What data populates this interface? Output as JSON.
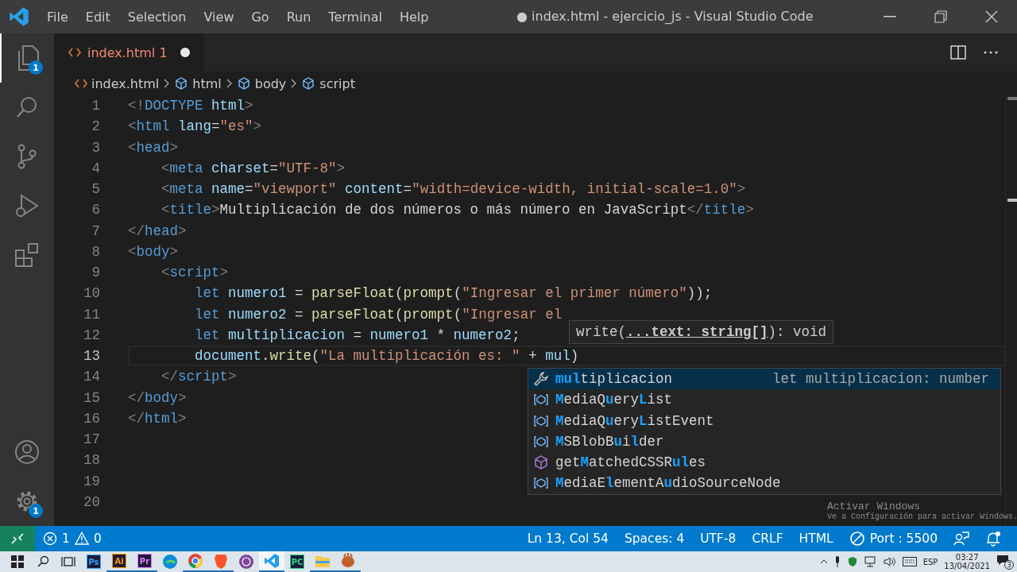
{
  "window": {
    "title": "● index.html - ejercicio_js - Visual Studio Code"
  },
  "menu": [
    "File",
    "Edit",
    "Selection",
    "View",
    "Go",
    "Run",
    "Terminal",
    "Help"
  ],
  "activity_bar": {
    "items": [
      {
        "kind": "files",
        "badge": "1",
        "selected": true
      },
      {
        "kind": "search",
        "selected": false
      },
      {
        "kind": "source-control",
        "selected": false
      },
      {
        "kind": "run",
        "selected": false
      },
      {
        "kind": "extensions",
        "selected": false
      }
    ],
    "bottom": [
      {
        "kind": "account"
      },
      {
        "kind": "settings",
        "badge": "1"
      }
    ]
  },
  "tabs": [
    {
      "label": "index.html",
      "problems": "1",
      "dirty": true,
      "selected": true
    }
  ],
  "breadcrumb": [
    {
      "kind": "file",
      "label": "index.html"
    },
    {
      "kind": "element",
      "label": "html"
    },
    {
      "kind": "element",
      "label": "body"
    },
    {
      "kind": "element",
      "label": "script"
    }
  ],
  "editor": {
    "lines": [
      {
        "number": "1",
        "current": false,
        "tokens": [
          {
            "kind": "punct",
            "text": "<!"
          },
          {
            "kind": "tag",
            "text": "DOCTYPE"
          },
          {
            "kind": "attr",
            "text": " html"
          },
          {
            "kind": "punct",
            "text": ">"
          }
        ]
      },
      {
        "number": "2",
        "current": false,
        "tokens": [
          {
            "kind": "punct",
            "text": "<"
          },
          {
            "kind": "tag",
            "text": "html"
          },
          {
            "kind": "attr",
            "text": " lang"
          },
          {
            "kind": "text",
            "text": "="
          },
          {
            "kind": "str",
            "text": "\"es\""
          },
          {
            "kind": "punct",
            "text": ">"
          }
        ]
      },
      {
        "number": "3",
        "current": false,
        "tokens": [
          {
            "kind": "punct",
            "text": "<"
          },
          {
            "kind": "tag",
            "text": "head"
          },
          {
            "kind": "punct",
            "text": ">"
          }
        ]
      },
      {
        "number": "4",
        "current": false,
        "tokens": [
          {
            "kind": "punct",
            "text": "    <"
          },
          {
            "kind": "tag",
            "text": "meta"
          },
          {
            "kind": "attr",
            "text": " charset"
          },
          {
            "kind": "text",
            "text": "="
          },
          {
            "kind": "str",
            "text": "\"UTF-8\""
          },
          {
            "kind": "punct",
            "text": ">"
          }
        ]
      },
      {
        "number": "5",
        "current": false,
        "tokens": [
          {
            "kind": "punct",
            "text": "    <"
          },
          {
            "kind": "tag",
            "text": "meta"
          },
          {
            "kind": "attr",
            "text": " name"
          },
          {
            "kind": "text",
            "text": "="
          },
          {
            "kind": "str",
            "text": "\"viewport\""
          },
          {
            "kind": "attr",
            "text": " content"
          },
          {
            "kind": "text",
            "text": "="
          },
          {
            "kind": "str",
            "text": "\"width=device-width, initial-scale=1.0\""
          },
          {
            "kind": "punct",
            "text": ">"
          }
        ]
      },
      {
        "number": "6",
        "current": false,
        "tokens": [
          {
            "kind": "punct",
            "text": "    <"
          },
          {
            "kind": "tag",
            "text": "title"
          },
          {
            "kind": "punct",
            "text": ">"
          },
          {
            "kind": "text",
            "text": "Multiplicación de dos números o más número en JavaScript"
          },
          {
            "kind": "punct",
            "text": "</"
          },
          {
            "kind": "tag",
            "text": "title"
          },
          {
            "kind": "punct",
            "text": ">"
          }
        ]
      },
      {
        "number": "7",
        "current": false,
        "tokens": [
          {
            "kind": "punct",
            "text": "</"
          },
          {
            "kind": "tag",
            "text": "head"
          },
          {
            "kind": "punct",
            "text": ">"
          }
        ]
      },
      {
        "number": "8",
        "current": false,
        "tokens": [
          {
            "kind": "punct",
            "text": "<"
          },
          {
            "kind": "tag",
            "text": "body"
          },
          {
            "kind": "punct",
            "text": ">"
          }
        ]
      },
      {
        "number": "9",
        "current": false,
        "tokens": [
          {
            "kind": "punct",
            "text": "    <"
          },
          {
            "kind": "tag",
            "text": "script"
          },
          {
            "kind": "punct",
            "text": ">"
          }
        ]
      },
      {
        "number": "10",
        "current": false,
        "tokens": [
          {
            "kind": "kw",
            "text": "        let"
          },
          {
            "kind": "var",
            "text": " numero1"
          },
          {
            "kind": "text",
            "text": " = "
          },
          {
            "kind": "fn",
            "text": "parseFloat"
          },
          {
            "kind": "text",
            "text": "("
          },
          {
            "kind": "fn",
            "text": "prompt"
          },
          {
            "kind": "text",
            "text": "("
          },
          {
            "kind": "str",
            "text": "\"Ingresar el primer número\""
          },
          {
            "kind": "text",
            "text": "));"
          }
        ]
      },
      {
        "number": "11",
        "current": false,
        "tokens": [
          {
            "kind": "kw",
            "text": "        let"
          },
          {
            "kind": "var",
            "text": " numero2"
          },
          {
            "kind": "text",
            "text": " = "
          },
          {
            "kind": "fn",
            "text": "parseFloat"
          },
          {
            "kind": "text",
            "text": "("
          },
          {
            "kind": "fn",
            "text": "prompt"
          },
          {
            "kind": "text",
            "text": "("
          },
          {
            "kind": "str",
            "text": "\"Ingresar el"
          }
        ]
      },
      {
        "number": "12",
        "current": false,
        "tokens": [
          {
            "kind": "kw",
            "text": "        let"
          },
          {
            "kind": "var",
            "text": " multiplicacion"
          },
          {
            "kind": "text",
            "text": " = "
          },
          {
            "kind": "var",
            "text": "numero1"
          },
          {
            "kind": "text",
            "text": " * "
          },
          {
            "kind": "var",
            "text": "numero2"
          },
          {
            "kind": "text",
            "text": ";"
          }
        ]
      },
      {
        "number": "13",
        "current": true,
        "tokens": [
          {
            "kind": "var",
            "text": "        document"
          },
          {
            "kind": "text",
            "text": "."
          },
          {
            "kind": "fn",
            "text": "write"
          },
          {
            "kind": "text",
            "text": "("
          },
          {
            "kind": "str",
            "text": "\"La multiplicación es: \""
          },
          {
            "kind": "text",
            "text": " + "
          },
          {
            "kind": "var",
            "text": "mul"
          },
          {
            "kind": "text",
            "text": ")"
          }
        ]
      },
      {
        "number": "14",
        "current": false,
        "tokens": [
          {
            "kind": "punct",
            "text": "    </"
          },
          {
            "kind": "tag",
            "text": "script"
          },
          {
            "kind": "punct",
            "text": ">"
          }
        ]
      },
      {
        "number": "15",
        "current": false,
        "tokens": [
          {
            "kind": "punct",
            "text": "</"
          },
          {
            "kind": "tag",
            "text": "body"
          },
          {
            "kind": "punct",
            "text": ">"
          }
        ]
      },
      {
        "number": "16",
        "current": false,
        "tokens": [
          {
            "kind": "punct",
            "text": "</"
          },
          {
            "kind": "tag",
            "text": "html"
          },
          {
            "kind": "punct",
            "text": ">"
          }
        ]
      },
      {
        "number": "17",
        "current": false
      },
      {
        "number": "18",
        "current": false
      },
      {
        "number": "19",
        "current": false
      },
      {
        "number": "20",
        "current": false
      }
    ],
    "signature_hint": "write(**...text: string[]**): void",
    "suggestions": [
      {
        "kind": "snippet",
        "label": "**mul**tiplicacion",
        "detail": "let multiplicacion: number",
        "selected": true
      },
      {
        "kind": "variable",
        "label": "**M**ediaQ**u**ery**L**ist",
        "selected": false
      },
      {
        "kind": "variable",
        "label": "**M**ediaQ**u**ery**L**istEvent",
        "selected": false
      },
      {
        "kind": "variable",
        "label": "**M**SBlobB**u**i**l**der",
        "selected": false
      },
      {
        "kind": "method",
        "label": "get**M**atchedCSSR**ul**es",
        "selected": false
      },
      {
        "kind": "variable",
        "label": "**M**ediaE**l**ementA**u**dioSourceNode",
        "selected": false
      }
    ]
  },
  "activation": {
    "title": "Activar Windows",
    "subtitle": "Ve a Configuración para activar Windows."
  },
  "status_bar": {
    "errors": "1",
    "warnings": "0",
    "right": [
      {
        "kind": "text",
        "label": "Ln 13, Col 54"
      },
      {
        "kind": "text",
        "label": "Spaces: 4"
      },
      {
        "kind": "text",
        "label": "UTF-8"
      },
      {
        "kind": "text",
        "label": "CRLF"
      },
      {
        "kind": "text",
        "label": "HTML"
      },
      {
        "kind": "port",
        "label": "Port : 5500"
      },
      {
        "kind": "feedback"
      },
      {
        "kind": "bell"
      }
    ]
  },
  "taskbar": {
    "items": [
      {
        "kind": "start",
        "running": false,
        "selected": false
      },
      {
        "kind": "search",
        "running": false,
        "selected": false
      },
      {
        "kind": "taskview",
        "running": false,
        "selected": false
      },
      {
        "kind": "badge",
        "label": "Ps",
        "color": "#31a8ff",
        "running": false,
        "selected": false
      },
      {
        "kind": "badge",
        "label": "Ai",
        "color": "#ff9a00",
        "running": true,
        "selected": false
      },
      {
        "kind": "badge",
        "label": "Pr",
        "color": "#ea77ff",
        "running": true,
        "selected": false
      },
      {
        "kind": "edge",
        "running": false,
        "selected": false
      },
      {
        "kind": "chrome",
        "running": true,
        "selected": false
      },
      {
        "kind": "brave",
        "running": true,
        "selected": false
      },
      {
        "kind": "tor",
        "running": false,
        "selected": false
      },
      {
        "kind": "vscode",
        "running": true,
        "selected": true
      },
      {
        "kind": "pycharm",
        "label": "PC",
        "color": "#21d789",
        "running": false,
        "selected": false
      },
      {
        "kind": "folder",
        "running": true,
        "selected": false
      },
      {
        "kind": "game",
        "running": true,
        "selected": false
      }
    ],
    "tray": {
      "language": "ESP",
      "time": "03:27",
      "date": "13/04/2021",
      "notifications": "3"
    }
  }
}
